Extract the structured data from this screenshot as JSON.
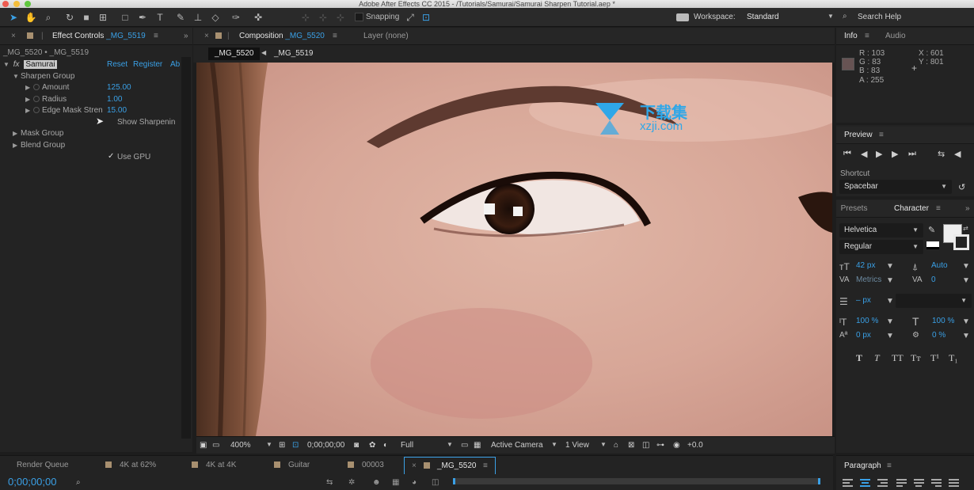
{
  "window": {
    "title": "Adobe After Effects CC 2015 - /Tutorials/Samurai/Samurai Sharpen Tutorial.aep *"
  },
  "toolbar": {
    "snapping_label": "Snapping",
    "workspace_label": "Workspace:",
    "workspace_value": "Standard",
    "search_help": "Search Help"
  },
  "effect_controls": {
    "tab_label": "Effect Controls",
    "tab_layer": "_MG_5519",
    "breadcrumb": "_MG_5520 • _MG_5519",
    "effect_name": "Samurai",
    "fx_label": "fx",
    "reset": "Reset",
    "register": "Register",
    "about": "Ab",
    "sharpen_group": "Sharpen Group",
    "params": [
      {
        "name": "Amount",
        "value": "125.00"
      },
      {
        "name": "Radius",
        "value": "1.00"
      },
      {
        "name": "Edge Mask Stren",
        "value": "15.00"
      }
    ],
    "show_sharpening": "Show Sharpenin",
    "mask_group": "Mask Group",
    "blend_group": "Blend Group",
    "use_gpu": "Use GPU",
    "checkmark": "✓"
  },
  "composition": {
    "tab_label": "Composition",
    "tab_comp": "_MG_5520",
    "layer_label": "Layer (none)",
    "flow_active": "_MG_5520",
    "flow_next": "_MG_5519",
    "zoom": "400%",
    "timecode": "0;00;00;00",
    "resolution": "Full",
    "camera": "Active Camera",
    "views": "1 View",
    "exposure": "+0.0"
  },
  "info": {
    "tab_info": "Info",
    "tab_audio": "Audio",
    "r": "R : 103",
    "g": "G : 83",
    "b": "B : 83",
    "a": "A : 255",
    "x": "X : 601",
    "y": "Y : 801",
    "swatch_color": "#675353"
  },
  "preview": {
    "title": "Preview",
    "shortcut_label": "Shortcut",
    "shortcut_value": "Spacebar"
  },
  "character": {
    "tab_presets": "Presets",
    "tab_character": "Character",
    "font": "Helvetica",
    "style": "Regular",
    "size": "42 px",
    "leading": "Auto",
    "kerning": "Metrics",
    "tracking": "0",
    "stroke": "– px",
    "vscale": "100 %",
    "hscale": "100 %",
    "baseline": "0 px",
    "tsume": "0 %",
    "styles": [
      "T",
      "T",
      "TT",
      "Tт",
      "T¹",
      "T₁"
    ]
  },
  "timeline": {
    "tabs": [
      "Render Queue",
      "4K at 62%",
      "4K at 4K",
      "Guitar",
      "00003",
      "_MG_5520"
    ],
    "timecode": "0;00;00;00"
  },
  "paragraph": {
    "title": "Paragraph"
  },
  "watermark": {
    "cn": "下载集",
    "url": "xzji.com"
  },
  "colors": {
    "accent": "#3aa0e6",
    "label_tan": "#a89070"
  }
}
